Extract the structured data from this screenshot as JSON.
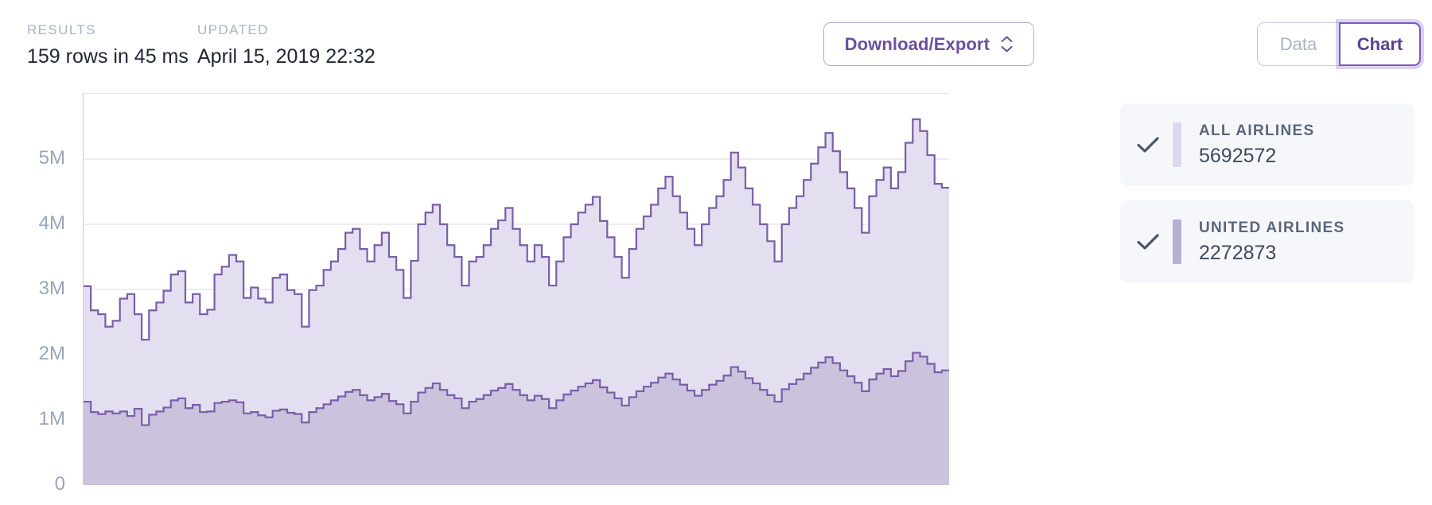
{
  "header": {
    "results_label": "RESULTS",
    "results_value": "159 rows in 45 ms",
    "updated_label": "UPDATED",
    "updated_value": "April 15, 2019 22:32"
  },
  "toolbar": {
    "export_label": "Download/Export",
    "export_icon": "chevron-up-down-icon",
    "view_toggle": {
      "data_label": "Data",
      "chart_label": "Chart",
      "selected": "Chart"
    }
  },
  "legend": {
    "check_icon": "check-icon",
    "items": [
      {
        "name": "ALL AIRLINES",
        "value": "5692572",
        "color": "#ded8ee",
        "checked": true
      },
      {
        "name": "UNITED AIRLINES",
        "value": "2272873",
        "color": "#b9aed4",
        "checked": true
      }
    ]
  },
  "chart_data": {
    "type": "area",
    "title": "",
    "xlabel": "",
    "ylabel": "",
    "grid": true,
    "legend_position": "right",
    "step": "pre",
    "stacked": false,
    "row_count": 159,
    "ylim": [
      0,
      6000000
    ],
    "yticks": [
      0,
      1000000,
      2000000,
      3000000,
      4000000,
      5000000
    ],
    "ytick_labels": [
      "0",
      "1M",
      "2M",
      "3M",
      "4M",
      "5M"
    ],
    "colors": {
      "all_airlines_fill": "#e3dff0",
      "all_airlines_stroke": "#7a5ea8",
      "united_fill": "#cbc3de",
      "united_stroke": "#7a5ea8",
      "axis": "#c9ccd4",
      "gridline": "#e8e6ef",
      "accent": "#6b4fa0",
      "muted_text": "#a9b2c3",
      "value_text": "#1f2733"
    },
    "series": [
      {
        "name": "ALL AIRLINES",
        "total": 5692572,
        "values": [
          3050000,
          2680000,
          2620000,
          2430000,
          2520000,
          2860000,
          2930000,
          2620000,
          2230000,
          2680000,
          2800000,
          2980000,
          3230000,
          3280000,
          2800000,
          2930000,
          2620000,
          2690000,
          3230000,
          3350000,
          3530000,
          3430000,
          2870000,
          3030000,
          2860000,
          2800000,
          3180000,
          3230000,
          2990000,
          2930000,
          2430000,
          2990000,
          3060000,
          3300000,
          3430000,
          3620000,
          3870000,
          3930000,
          3620000,
          3430000,
          3680000,
          3870000,
          3500000,
          3300000,
          2870000,
          3440000,
          4000000,
          4180000,
          4300000,
          4000000,
          3680000,
          3500000,
          3060000,
          3430000,
          3500000,
          3680000,
          3930000,
          4060000,
          4250000,
          3930000,
          3680000,
          3430000,
          3680000,
          3500000,
          3060000,
          3430000,
          3800000,
          4000000,
          4180000,
          4300000,
          4420000,
          4050000,
          3800000,
          3500000,
          3180000,
          3620000,
          3930000,
          4120000,
          4300000,
          4550000,
          4730000,
          4430000,
          4180000,
          3930000,
          3680000,
          4000000,
          4250000,
          4430000,
          4680000,
          5100000,
          4870000,
          4550000,
          4300000,
          4000000,
          3740000,
          3430000,
          4000000,
          4250000,
          4430000,
          4680000,
          4930000,
          5180000,
          5400000,
          5120000,
          4800000,
          4550000,
          4250000,
          3870000,
          4430000,
          4680000,
          4870000,
          4550000,
          4800000,
          5250000,
          5610000,
          5430000,
          5060000,
          4620000,
          4560000
        ]
      },
      {
        "name": "UNITED AIRLINES",
        "total": 2272873,
        "values": [
          1280000,
          1120000,
          1090000,
          1130000,
          1100000,
          1130000,
          1060000,
          1170000,
          920000,
          1080000,
          1130000,
          1190000,
          1300000,
          1330000,
          1180000,
          1230000,
          1120000,
          1130000,
          1260000,
          1280000,
          1300000,
          1270000,
          1100000,
          1120000,
          1070000,
          1040000,
          1140000,
          1160000,
          1110000,
          1090000,
          960000,
          1120000,
          1180000,
          1240000,
          1300000,
          1360000,
          1430000,
          1460000,
          1380000,
          1300000,
          1350000,
          1400000,
          1290000,
          1240000,
          1100000,
          1280000,
          1420000,
          1490000,
          1560000,
          1460000,
          1380000,
          1330000,
          1180000,
          1280000,
          1320000,
          1380000,
          1450000,
          1490000,
          1550000,
          1460000,
          1380000,
          1300000,
          1370000,
          1320000,
          1180000,
          1300000,
          1390000,
          1450000,
          1510000,
          1560000,
          1610000,
          1500000,
          1420000,
          1330000,
          1220000,
          1350000,
          1440000,
          1510000,
          1570000,
          1650000,
          1710000,
          1620000,
          1540000,
          1450000,
          1370000,
          1460000,
          1540000,
          1600000,
          1680000,
          1810000,
          1740000,
          1640000,
          1560000,
          1460000,
          1380000,
          1280000,
          1470000,
          1550000,
          1620000,
          1710000,
          1800000,
          1880000,
          1960000,
          1870000,
          1760000,
          1670000,
          1570000,
          1440000,
          1620000,
          1710000,
          1780000,
          1670000,
          1750000,
          1900000,
          2030000,
          1970000,
          1860000,
          1730000,
          1760000
        ]
      }
    ]
  }
}
